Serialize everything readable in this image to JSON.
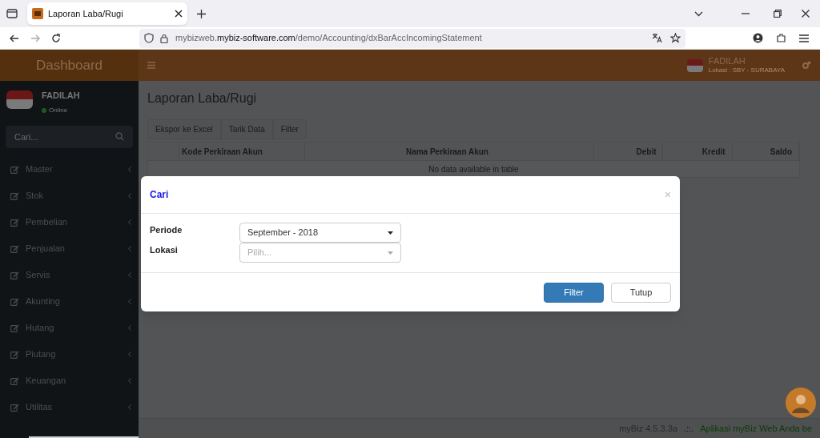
{
  "browser": {
    "tab_title": "Laporan Laba/Rugi",
    "url": "mybizweb.**mybiz-software.com**/demo/Accounting/dxBarAccIncomingStatement"
  },
  "header": {
    "brand": "Dashboard",
    "user_name": "FADILAH",
    "location": "Lokasi : SBY - SURABAYA"
  },
  "sidebar": {
    "user_name": "FADILAH",
    "status": "Online",
    "search_placeholder": "Cari...",
    "items": [
      {
        "label": "Master"
      },
      {
        "label": "Stok"
      },
      {
        "label": "Pembelian"
      },
      {
        "label": "Penjualan"
      },
      {
        "label": "Servis"
      },
      {
        "label": "Akunting"
      },
      {
        "label": "Hutang"
      },
      {
        "label": "Piutang"
      },
      {
        "label": "Keuangan"
      },
      {
        "label": "Utilitas"
      }
    ]
  },
  "page": {
    "title": "Laporan Laba/Rugi",
    "toolbar": [
      "Ekspor ke Excel",
      "Tarik Data",
      "Filter"
    ],
    "table": {
      "columns": [
        "Kode Perkiraan Akun",
        "Nama Perkiraan Akun",
        "Debit",
        "Kredit",
        "Saldo"
      ],
      "empty_message": "No data available in table"
    }
  },
  "modal": {
    "title": "Cari",
    "close": "×",
    "fields": [
      {
        "label": "Periode",
        "value": "September - 2018"
      },
      {
        "label": "Lokasi",
        "placeholder": "Pilih..."
      }
    ],
    "buttons": [
      {
        "label": "Filter",
        "kind": "primary"
      },
      {
        "label": "Tutup",
        "kind": "default"
      }
    ]
  },
  "footer": {
    "version": "myBiz 4.5.3.3a",
    "separator": ".::.",
    "message": "Aplikasi myBiz Web Anda be"
  }
}
